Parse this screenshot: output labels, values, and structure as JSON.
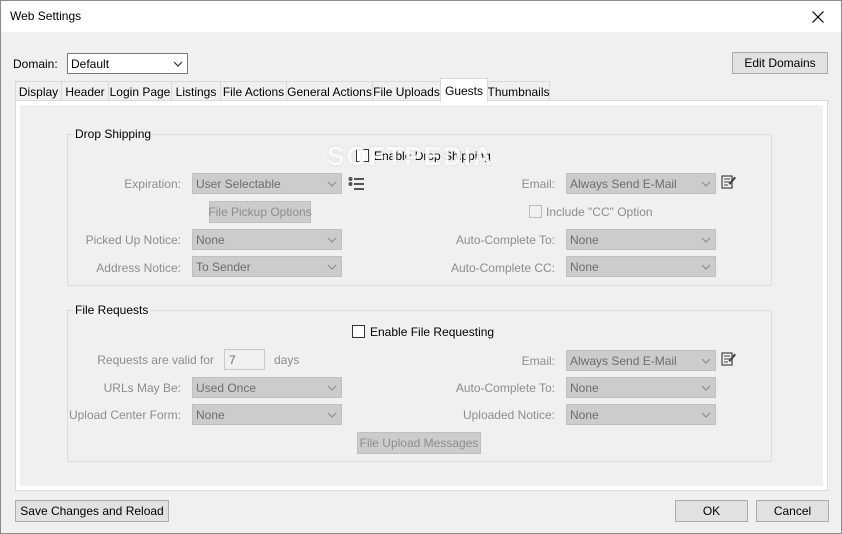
{
  "window": {
    "title": "Web Settings"
  },
  "domain": {
    "label": "Domain:",
    "value": "Default",
    "edit_button": "Edit Domains"
  },
  "tabs": [
    {
      "label": "Display"
    },
    {
      "label": "Header"
    },
    {
      "label": "Login Page"
    },
    {
      "label": "Listings"
    },
    {
      "label": "File Actions"
    },
    {
      "label": "General Actions"
    },
    {
      "label": "File Uploads"
    },
    {
      "label": "Guests"
    },
    {
      "label": "Thumbnails"
    }
  ],
  "active_tab": "Guests",
  "watermark": "SOFTPEDIA",
  "drop_shipping": {
    "title": "Drop Shipping",
    "enable_label": "Enable Drop Shipping",
    "enabled": false,
    "expiration_label": "Expiration:",
    "expiration_value": "User Selectable",
    "file_pickup_button": "File Pickup Options",
    "picked_up_label": "Picked Up Notice:",
    "picked_up_value": "None",
    "address_notice_label": "Address Notice:",
    "address_notice_value": "To Sender",
    "email_label": "Email:",
    "email_value": "Always Send E-Mail",
    "include_cc_label": "Include \"CC\" Option",
    "include_cc_checked": false,
    "autocomplete_to_label": "Auto-Complete To:",
    "autocomplete_to_value": "None",
    "autocomplete_cc_label": "Auto-Complete CC:",
    "autocomplete_cc_value": "None"
  },
  "file_requests": {
    "title": "File Requests",
    "enable_label": "Enable File Requesting",
    "enabled": false,
    "valid_for_label": "Requests are valid for",
    "valid_for_value": "7",
    "days_label": "days",
    "urls_label": "URLs May Be:",
    "urls_value": "Used Once",
    "upload_form_label": "Upload Center Form:",
    "upload_form_value": "None",
    "email_label": "Email:",
    "email_value": "Always Send E-Mail",
    "autocomplete_to_label": "Auto-Complete To:",
    "autocomplete_to_value": "None",
    "uploaded_notice_label": "Uploaded Notice:",
    "uploaded_notice_value": "None",
    "messages_button": "File Upload Messages"
  },
  "footer": {
    "save_reload": "Save Changes and Reload",
    "ok": "OK",
    "cancel": "Cancel"
  }
}
